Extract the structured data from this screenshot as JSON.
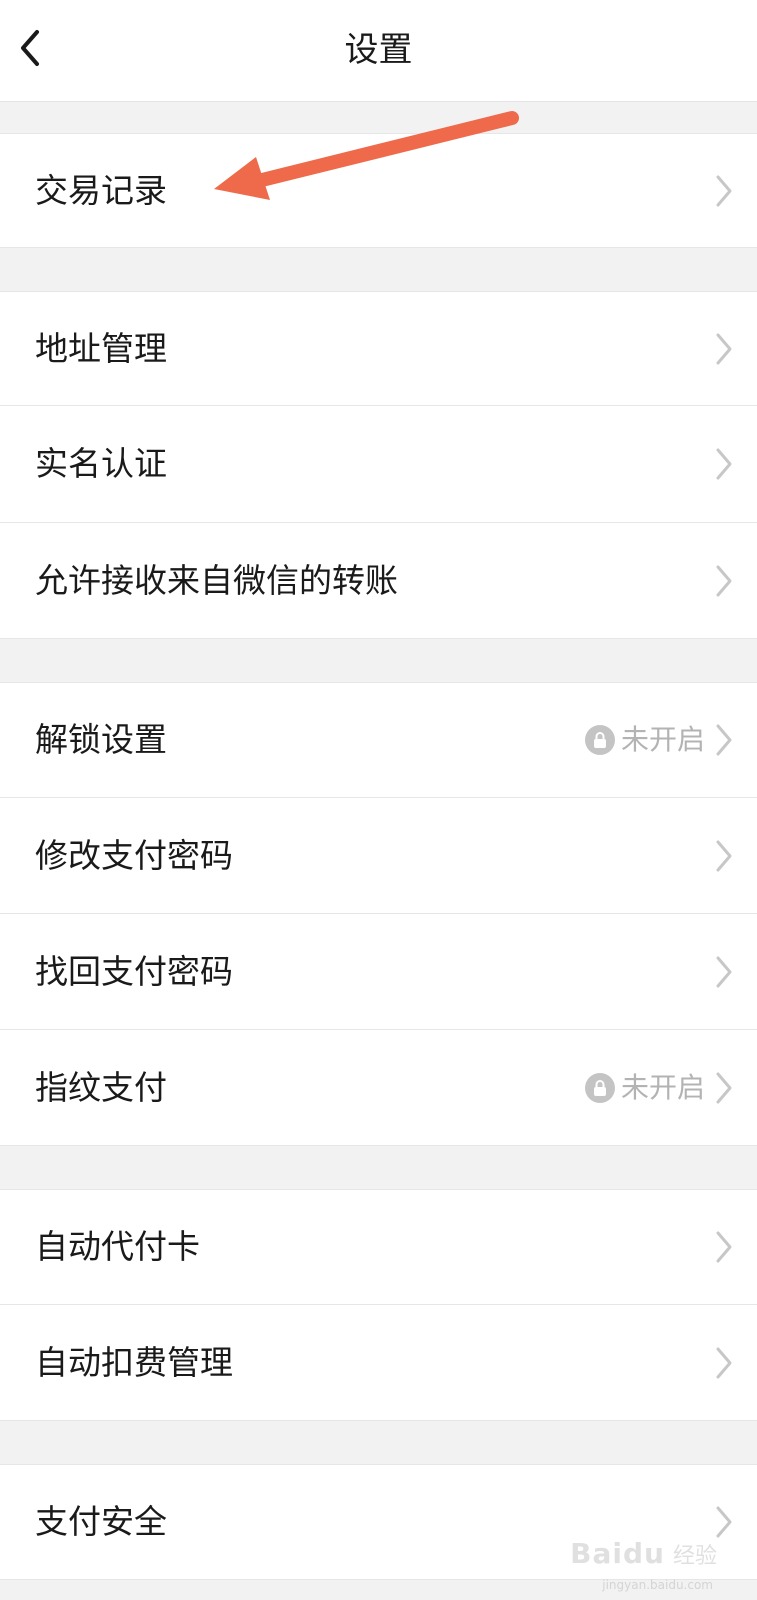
{
  "header": {
    "title": "设置"
  },
  "rows": [
    {
      "label": "交易记录"
    },
    {
      "label": "地址管理"
    },
    {
      "label": "实名认证"
    },
    {
      "label": "允许接收来自微信的转账"
    },
    {
      "label": "解锁设置",
      "status": "未开启"
    },
    {
      "label": "修改支付密码"
    },
    {
      "label": "找回支付密码"
    },
    {
      "label": "指纹支付",
      "status": "未开启"
    },
    {
      "label": "自动代付卡"
    },
    {
      "label": "自动扣费管理"
    },
    {
      "label": "支付安全"
    }
  ],
  "watermark": {
    "logo": "Baidu",
    "text": "经验",
    "url": "jingyan.baidu.com"
  },
  "colors": {
    "page_background": "#f2f2f2",
    "annotation_arrow": "#ee6a4a",
    "status_text": "#b3b3b3"
  },
  "icons": {
    "back": "chevron-left-icon",
    "row_arrow": "chevron-right-icon",
    "status": "lock-icon"
  }
}
